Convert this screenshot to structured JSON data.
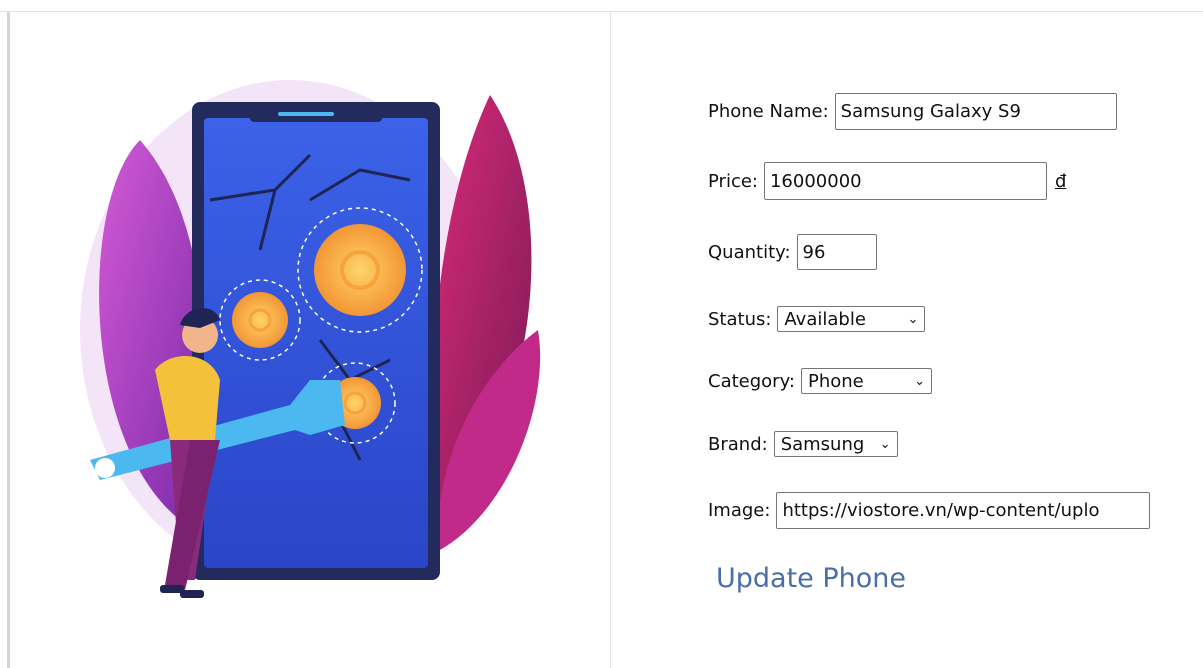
{
  "form": {
    "phone_name": {
      "label": "Phone Name:",
      "value": "Samsung Galaxy S9"
    },
    "price": {
      "label": "Price:",
      "value": "16000000",
      "currency": "đ"
    },
    "quantity": {
      "label": "Quantity:",
      "value": "96"
    },
    "status": {
      "label": "Status:",
      "selected": "Available"
    },
    "category": {
      "label": "Category:",
      "selected": "Phone"
    },
    "brand": {
      "label": "Brand:",
      "selected": "Samsung"
    },
    "image": {
      "label": "Image:",
      "value": "https://viostore.vn/wp-content/uplo"
    },
    "submit_label": "Update Phone"
  },
  "illustration": {
    "icon": "phone-repair-illustration"
  }
}
